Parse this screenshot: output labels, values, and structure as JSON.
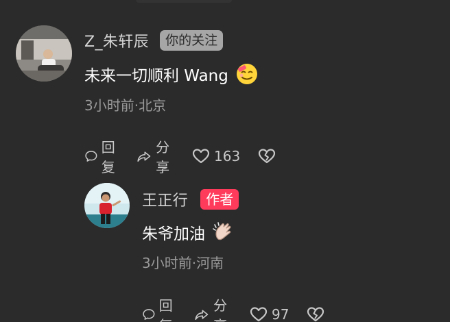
{
  "comments": [
    {
      "user": "Z_朱轩辰",
      "badge": "你的关注",
      "text": "未来一切顺利 Wang",
      "emoji": "smiling-face-with-bandage-icon",
      "time": "3小时前",
      "location": "北京",
      "meta": "3小时前·北京",
      "actions": {
        "reply": "回复",
        "share": "分享",
        "likes": "163"
      }
    },
    {
      "user": "王正行",
      "badge": "作者",
      "text": "朱爷加油",
      "emoji": "clapping-hands-icon",
      "time": "3小时前",
      "location": "河南",
      "meta": "3小时前·河南",
      "actions": {
        "reply": "回复",
        "share": "分享",
        "likes": "97"
      }
    }
  ],
  "colors": {
    "background": "#2b2b2b",
    "author_badge": "#ff3b5c",
    "follow_badge": "#a6a6a6",
    "meta_text": "#9a9a9a"
  }
}
